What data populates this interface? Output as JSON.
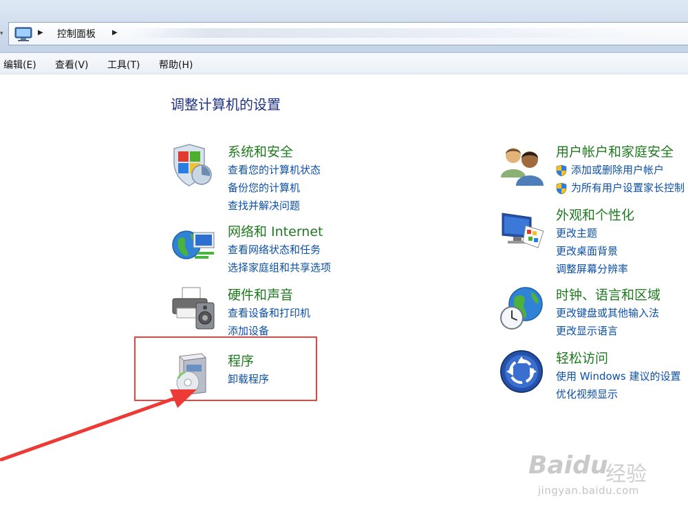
{
  "address_bar": {
    "crumbs": [
      "控制面板"
    ]
  },
  "menu": {
    "items": [
      "编辑(E)",
      "查看(V)",
      "工具(T)",
      "帮助(H)"
    ]
  },
  "page": {
    "title": "调整计算机的设置"
  },
  "categories": [
    {
      "title": "系统和安全",
      "links": [
        "查看您的计算机状态",
        "备份您的计算机",
        "查找并解决问题"
      ]
    },
    {
      "title": "网络和 Internet",
      "links": [
        "查看网络状态和任务",
        "选择家庭组和共享选项"
      ]
    },
    {
      "title": "硬件和声音",
      "links": [
        "查看设备和打印机",
        "添加设备"
      ]
    },
    {
      "title": "程序",
      "links": [
        "卸载程序"
      ]
    },
    {
      "title": "用户帐户和家庭安全",
      "links": [
        "添加或删除用户帐户",
        "为所有用户设置家长控制"
      ]
    },
    {
      "title": "外观和个性化",
      "links": [
        "更改主题",
        "更改桌面背景",
        "调整屏幕分辨率"
      ]
    },
    {
      "title": "时钟、语言和区域",
      "links": [
        "更改键盘或其他输入法",
        "更改显示语言"
      ]
    },
    {
      "title": "轻松访问",
      "links": [
        "使用 Windows 建议的设置",
        "优化视频显示"
      ]
    }
  ],
  "icons": {
    "system_security": "shield-chart-icon",
    "network": "globe-network-icon",
    "hardware": "printer-speaker-icon",
    "programs": "program-box-disc-icon",
    "user_accounts": "users-icon",
    "appearance": "monitor-palette-icon",
    "clock_language": "globe-clock-icon",
    "ease_of_access": "ease-of-access-icon"
  },
  "watermark": {
    "logo": "Baidu",
    "logo_cn": "经验",
    "url": "jingyan.baidu.com"
  },
  "colors": {
    "category_title": "#1e7a1e",
    "link": "#0b4fa8",
    "page_title": "#1e3287",
    "highlight": "#e8443e"
  }
}
